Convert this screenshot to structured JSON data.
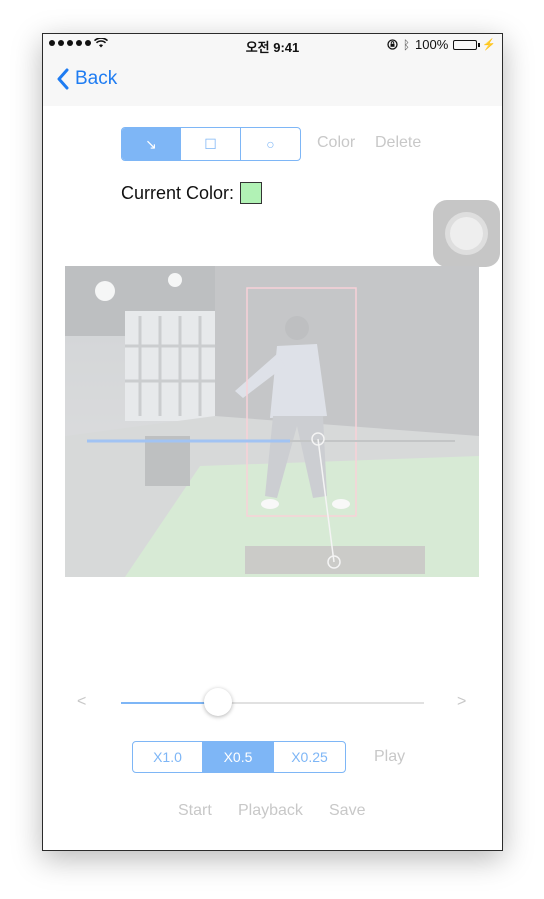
{
  "status": {
    "signal_dots": 5,
    "time": "오전 9:41",
    "battery": "100%",
    "battery_level": 1.0
  },
  "nav": {
    "back_label": "Back"
  },
  "tools": {
    "items": [
      {
        "icon": "arrow-icon",
        "glyph": "↘",
        "active": true
      },
      {
        "icon": "square-icon",
        "glyph": "☐",
        "active": false
      },
      {
        "icon": "circle-icon",
        "glyph": "○",
        "active": false
      }
    ],
    "color_label": "Color",
    "delete_label": "Delete"
  },
  "current_color": {
    "label": "Current Color:",
    "value": "#b1f2b5"
  },
  "playback": {
    "prev_glyph": "<",
    "next_glyph": ">",
    "progress": 0.32,
    "speeds": [
      {
        "label": "X1.0",
        "active": false
      },
      {
        "label": "X0.5",
        "active": true
      },
      {
        "label": "X0.25",
        "active": false
      }
    ],
    "play_label": "Play",
    "start_label": "Start",
    "playback_label": "Playback",
    "save_label": "Save"
  },
  "colors": {
    "accent": "#1e7cf2",
    "segment": "#7eb6f6",
    "disabled_text": "#c8c8c8",
    "annotation_box": "#ef9aa8",
    "line": "#2f7ae5"
  }
}
